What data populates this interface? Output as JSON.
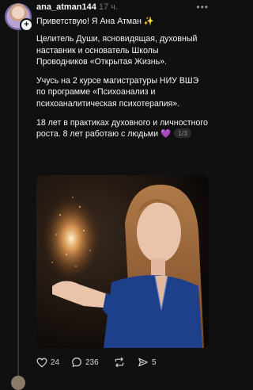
{
  "post": {
    "username": "ana_atman144",
    "time": "17 ч.",
    "paragraphs": [
      "Приветствую! Я Ана Атман ✨",
      "Целитель Души, ясновидящая, духовный наставник и основатель Школы Проводников «Открытая Жизнь».",
      "Учусь на 2 курсе магистратуры НИУ ВШЭ по программе «Психоанализ и психоаналитическая психотерапия».",
      "18 лет в практиках духовного и личностного роста. 8 лет работаю с людьми 💜"
    ],
    "page_indicator": "1/3"
  },
  "actions": {
    "likes": "24",
    "comments": "236",
    "shares": "5"
  },
  "icons": {
    "follow": "+",
    "more": "•••"
  }
}
